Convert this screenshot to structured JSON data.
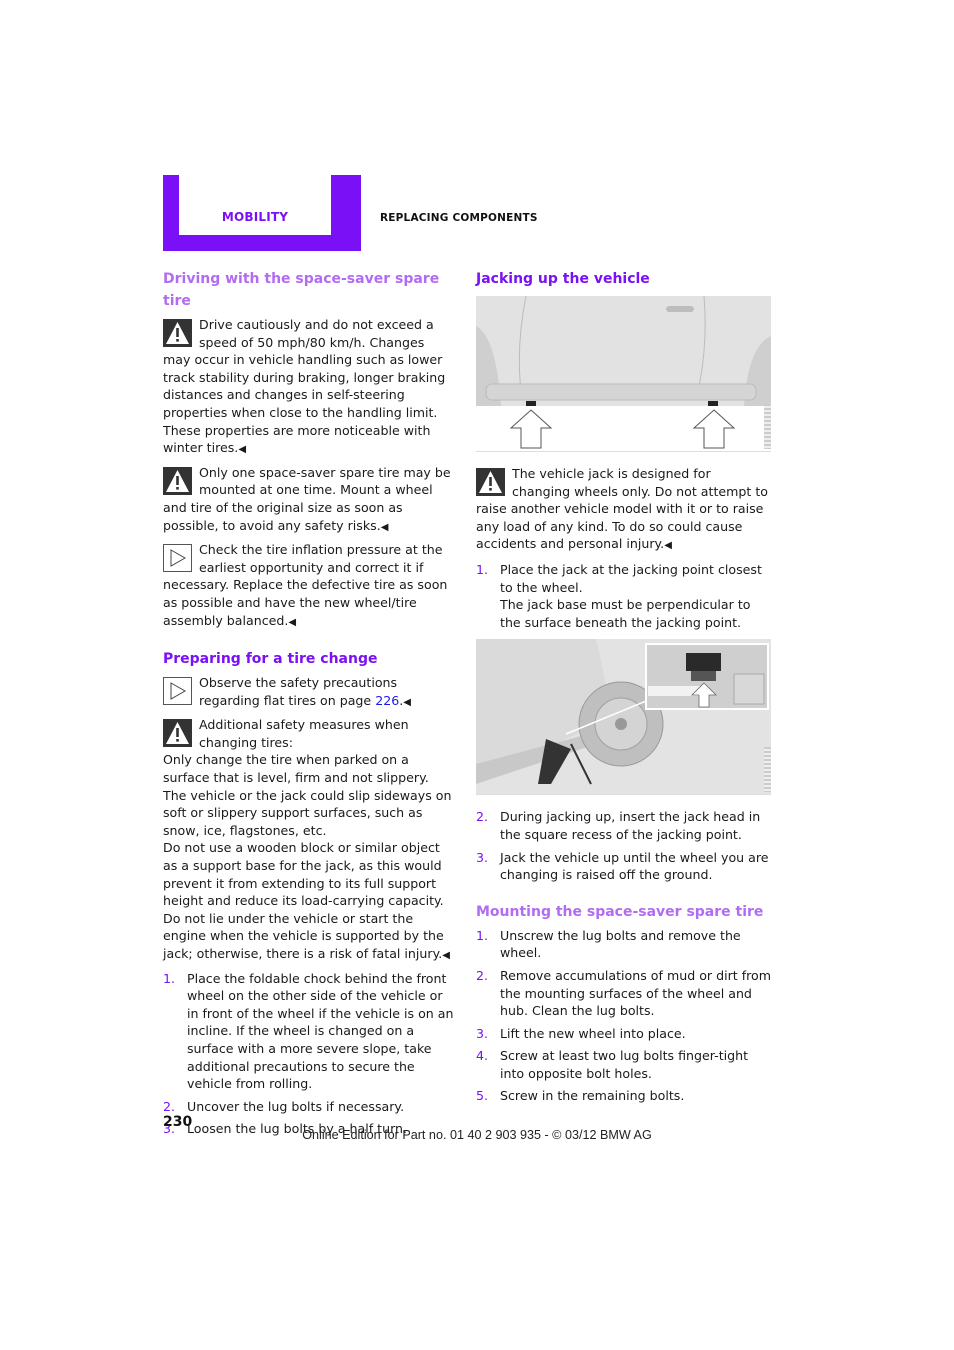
{
  "header": {
    "chapter_tab": "MOBILITY",
    "section": "REPLACING COMPONENTS",
    "accent_color": "#7a10f5"
  },
  "left_column": {
    "heading_driving": "Driving with the space-saver spare tire",
    "note_1": "Drive cautiously and do not exceed a speed of 50 mph/80 km/h. Changes may occur in vehicle handling such as lower track stability during braking, longer braking distances and changes in self-steering properties when close to the handling limit. These properties are more noticeable with winter tires.",
    "note_2": "Only one space-saver spare tire may be mounted at one time. Mount a wheel and tire of the original size as soon as possible, to avoid any safety risks.",
    "note_3": "Check the tire inflation pressure at the earliest opportunity and correct it if necessary. Replace the defective tire as soon as possible and have the new wheel/tire assembly balanced.",
    "heading_preparing": "Preparing for a tire change",
    "note_4_prefix": "Observe the safety precautions regarding flat tires on page ",
    "note_4_link": "226",
    "note_4_suffix": ".",
    "note_5_intro": "Additional safety measures when changing tires:",
    "note_5_p1": "Only change the tire when parked on a surface that is level, firm and not slippery.",
    "note_5_p2": "The vehicle or the jack could slip sideways on soft or slippery support surfaces, such as snow, ice, flagstones, etc.",
    "note_5_p3": "Do not use a wooden block or similar object as a support base for the jack, as this would prevent it from extending to its full support height and reduce its load-carrying capacity.",
    "note_5_p4": "Do not lie under the vehicle or start the engine when the vehicle is supported by the jack; otherwise, there is a risk of fatal injury.",
    "steps": [
      {
        "num": "1.",
        "text": "Place the foldable chock behind the front wheel on the other side of the vehicle or in front of the wheel if the vehicle is on an incline. If the wheel is changed on a surface with a more severe slope, take additional precautions to secure the vehicle from rolling."
      },
      {
        "num": "2.",
        "text": "Uncover the lug bolts if necessary."
      },
      {
        "num": "3.",
        "text": "Loosen the lug bolts by a half turn."
      }
    ]
  },
  "right_column": {
    "heading_jacking": "Jacking up the vehicle",
    "figure_1_alt": "Side of vehicle with arrows pointing to the jacking points",
    "note_6": "The vehicle jack is designed for changing wheels only. Do not attempt to raise another vehicle model with it or to raise any load of any kind. To do so could cause accidents and personal injury.",
    "jack_steps_a": [
      {
        "num": "1.",
        "text": "Place the jack at the jacking point closest to the wheel.",
        "extra": "The jack base must be perpendicular to the surface beneath the jacking point."
      }
    ],
    "figure_2_alt": "Jack positioned under the jacking point near the front wheel, with detail inset",
    "jack_steps_b": [
      {
        "num": "2.",
        "text": "During jacking up, insert the jack head in the square recess of the jacking point."
      },
      {
        "num": "3.",
        "text": "Jack the vehicle up until the wheel you are changing is raised off the ground."
      }
    ],
    "heading_mounting": "Mounting the space-saver spare tire",
    "mount_steps": [
      {
        "num": "1.",
        "text": "Unscrew the lug bolts and remove the wheel."
      },
      {
        "num": "2.",
        "text": "Remove accumulations of mud or dirt from the mounting surfaces of the wheel and hub. Clean the lug bolts."
      },
      {
        "num": "3.",
        "text": "Lift the new wheel into place."
      },
      {
        "num": "4.",
        "text": "Screw at least two lug bolts finger-tight into opposite bolt holes."
      },
      {
        "num": "5.",
        "text": "Screw in the remaining bolts."
      }
    ]
  },
  "footer": {
    "page_number": "230",
    "edition": "Online Edition for Part no. 01 40 2 903 935 - © 03/12 BMW AG"
  },
  "end_mark": "◀"
}
